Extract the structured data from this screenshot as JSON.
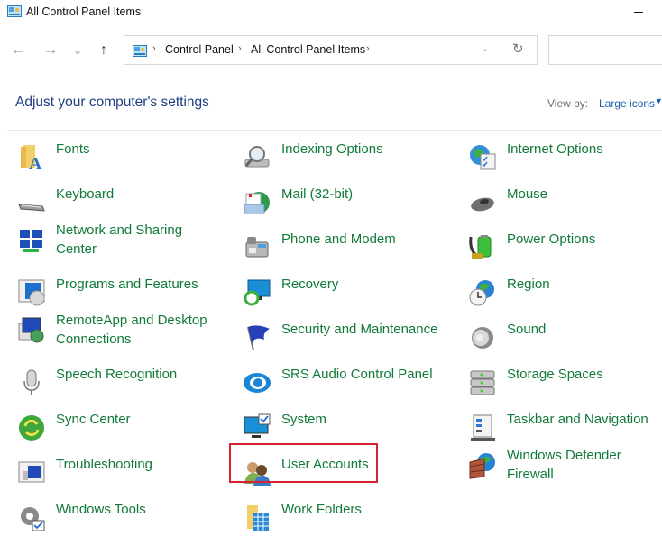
{
  "window": {
    "title": "All Control Panel Items",
    "app_icon": "control-panel-icon",
    "minimize_icon": "minimize-icon"
  },
  "nav": {
    "back_icon": "arrow-left-icon",
    "forward_icon": "arrow-right-icon",
    "recent_icon": "chevron-down-icon",
    "up_icon": "arrow-up-icon",
    "glyphs": {
      "back": "←",
      "forward": "→",
      "recent": "⌄",
      "up": "↑",
      "sep": "›",
      "dropdown": "⌄",
      "refresh": "↻",
      "viewarrow": "▼"
    }
  },
  "address": {
    "breadcrumbs": [
      "Control Panel",
      "All Control Panel Items"
    ],
    "search_placeholder": ""
  },
  "header": {
    "heading": "Adjust your computer's settings",
    "view_by_label": "View by:",
    "view_by_value": "Large icons"
  },
  "colors": {
    "link_green": "#117a3a",
    "heading_blue": "#1e3f80",
    "accent_blue": "#1a5fb4",
    "highlight_red": "#d5242f"
  },
  "items": [
    {
      "label": "Fonts",
      "icon": "fonts-folder-icon"
    },
    {
      "label": "Indexing Options",
      "icon": "indexing-options-icon"
    },
    {
      "label": "Internet Options",
      "icon": "internet-options-icon"
    },
    {
      "label": "Keyboard",
      "icon": "keyboard-icon"
    },
    {
      "label": "Mail (32-bit)",
      "icon": "mail-icon"
    },
    {
      "label": "Mouse",
      "icon": "mouse-icon"
    },
    {
      "label": "Network and Sharing Center",
      "icon": "network-icon"
    },
    {
      "label": "Phone and Modem",
      "icon": "phone-icon"
    },
    {
      "label": "Power Options",
      "icon": "battery-icon"
    },
    {
      "label": "Programs and Features",
      "icon": "programs-icon"
    },
    {
      "label": "Recovery",
      "icon": "recovery-icon"
    },
    {
      "label": "Region",
      "icon": "globe-clock-icon"
    },
    {
      "label": "RemoteApp and Desktop Connections",
      "icon": "remote-desktop-icon"
    },
    {
      "label": "Security and Maintenance",
      "icon": "flag-icon"
    },
    {
      "label": "Sound",
      "icon": "speaker-icon"
    },
    {
      "label": "Speech Recognition",
      "icon": "microphone-icon"
    },
    {
      "label": "SRS Audio Control Panel",
      "icon": "srs-audio-icon"
    },
    {
      "label": "Storage Spaces",
      "icon": "storage-drives-icon"
    },
    {
      "label": "Sync Center",
      "icon": "sync-icon"
    },
    {
      "label": "System",
      "icon": "monitor-check-icon"
    },
    {
      "label": "Taskbar and Navigation",
      "icon": "taskbar-icon"
    },
    {
      "label": "Troubleshooting",
      "icon": "troubleshooting-icon"
    },
    {
      "label": "User Accounts",
      "icon": "users-icon",
      "highlighted": true
    },
    {
      "label": "Windows Defender Firewall",
      "icon": "firewall-icon"
    },
    {
      "label": "Windows Tools",
      "icon": "gear-check-icon"
    },
    {
      "label": "Work Folders",
      "icon": "work-folders-icon"
    }
  ]
}
